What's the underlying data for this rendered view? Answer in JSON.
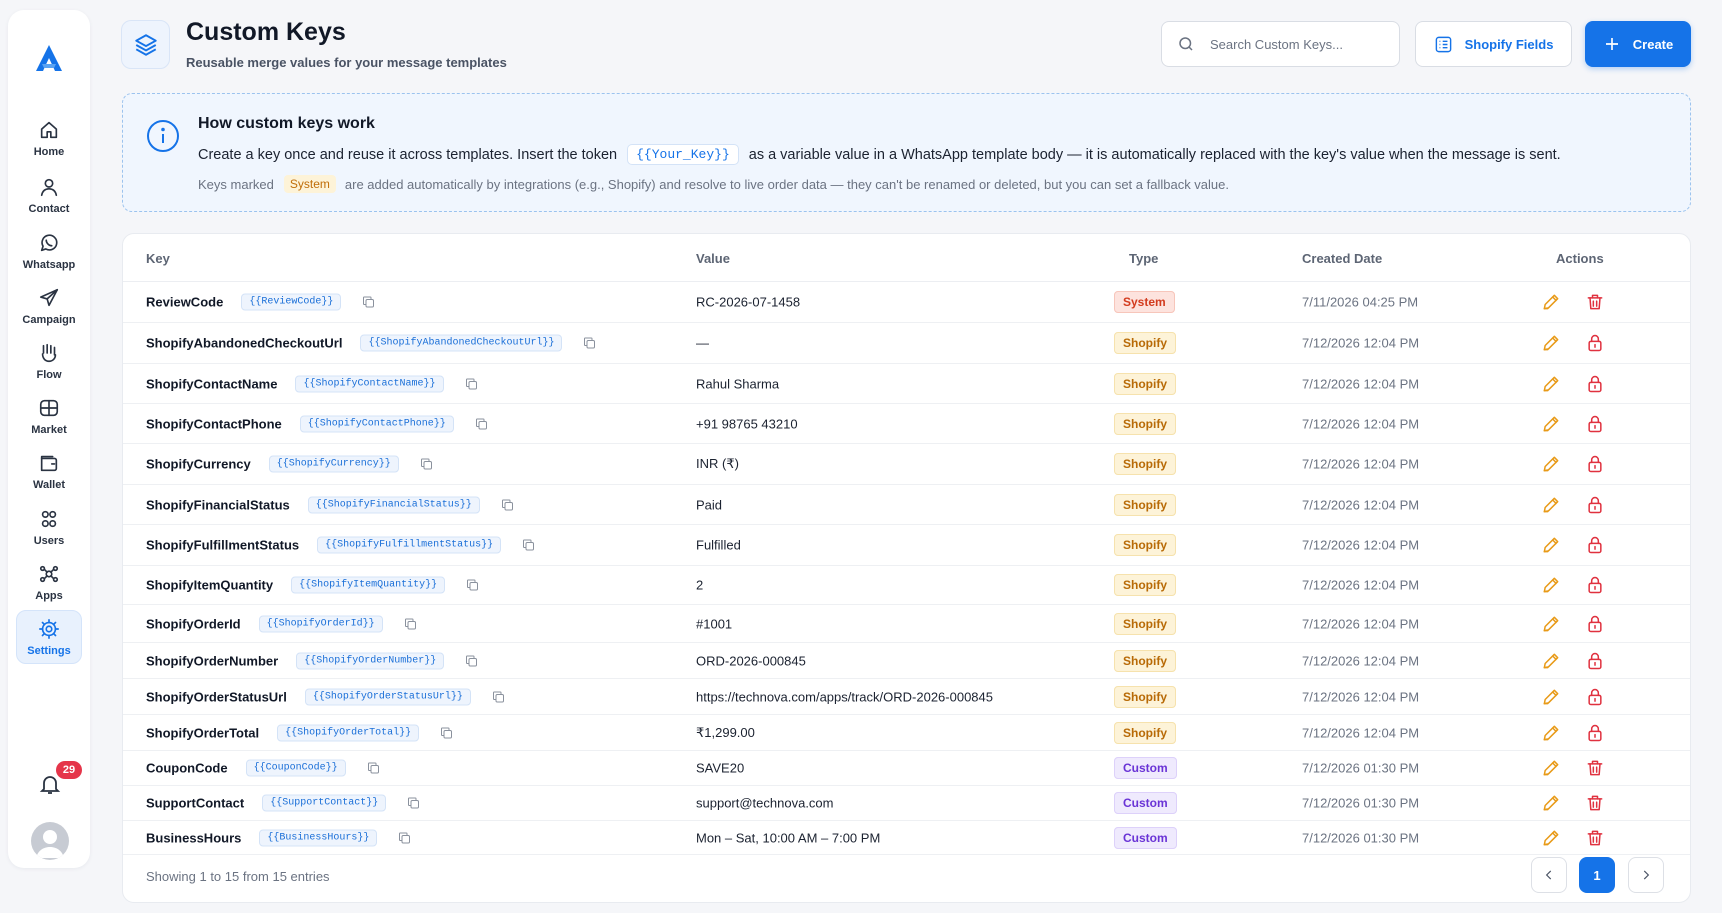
{
  "sidebar": {
    "items": [
      {
        "label": "Home",
        "icon": "home-icon"
      },
      {
        "label": "Contact",
        "icon": "user-icon"
      },
      {
        "label": "Whatsapp",
        "icon": "whatsapp-icon"
      },
      {
        "label": "Campaign",
        "icon": "send-icon"
      },
      {
        "label": "Flow",
        "icon": "flow-icon"
      },
      {
        "label": "Market",
        "icon": "store-icon"
      },
      {
        "label": "Wallet",
        "icon": "wallet-icon"
      },
      {
        "label": "Users",
        "icon": "users-icon"
      },
      {
        "label": "Apps",
        "icon": "apps-icon"
      },
      {
        "label": "Settings",
        "icon": "gear-icon",
        "active": true
      }
    ],
    "notification_count": "29"
  },
  "header": {
    "title": "Custom Keys",
    "subtitle": "Reusable merge values for your message templates",
    "search_placeholder": "Search Custom Keys...",
    "shopify_fields_label": "Shopify Fields",
    "create_label": "Create"
  },
  "info": {
    "title": "How custom keys work",
    "line1_before": "Create a key once and reuse it across templates. Insert the token",
    "line1_token": "{{Your_Key}}",
    "line1_after": "as a variable value in a WhatsApp template body — it is automatically replaced with the key's value when the message is sent.",
    "line2_before": "Keys marked",
    "line2_chip": "System",
    "line2_after": "are added automatically by integrations (e.g., Shopify) and resolve to live order data — they can't be renamed or deleted, but you can set a fallback value."
  },
  "table": {
    "headers": {
      "key": "Key",
      "value": "Value",
      "type": "Type",
      "created": "Created Date",
      "actions": "Actions"
    },
    "rows": [
      {
        "key": "ReviewCode",
        "token": "{{ReviewCode}}",
        "value": "RC-2026-07-1458",
        "type": "System",
        "date": "7/11/2026 04:25 PM"
      },
      {
        "key": "ShopifyAbandonedCheckoutUrl",
        "token": "{{ShopifyAbandonedCheckoutUrl}}",
        "value": "—",
        "type": "Shopify",
        "date": "7/12/2026 12:04 PM"
      },
      {
        "key": "ShopifyContactName",
        "token": "{{ShopifyContactName}}",
        "value": "Rahul Sharma",
        "type": "Shopify",
        "date": "7/12/2026 12:04 PM"
      },
      {
        "key": "ShopifyContactPhone",
        "token": "{{ShopifyContactPhone}}",
        "value": "+91 98765 43210",
        "type": "Shopify",
        "date": "7/12/2026 12:04 PM"
      },
      {
        "key": "ShopifyCurrency",
        "token": "{{ShopifyCurrency}}",
        "value": "INR (₹)",
        "type": "Shopify",
        "date": "7/12/2026 12:04 PM"
      },
      {
        "key": "ShopifyFinancialStatus",
        "token": "{{ShopifyFinancialStatus}}",
        "value": "Paid",
        "type": "Shopify",
        "date": "7/12/2026 12:04 PM"
      },
      {
        "key": "ShopifyFulfillmentStatus",
        "token": "{{ShopifyFulfillmentStatus}}",
        "value": "Fulfilled",
        "type": "Shopify",
        "date": "7/12/2026 12:04 PM"
      },
      {
        "key": "ShopifyItemQuantity",
        "token": "{{ShopifyItemQuantity}}",
        "value": "2",
        "type": "Shopify",
        "date": "7/12/2026 12:04 PM"
      },
      {
        "key": "ShopifyOrderId",
        "token": "{{ShopifyOrderId}}",
        "value": "#1001",
        "type": "Shopify",
        "date": "7/12/2026 12:04 PM"
      },
      {
        "key": "ShopifyOrderNumber",
        "token": "{{ShopifyOrderNumber}}",
        "value": "ORD-2026-000845",
        "type": "Shopify",
        "date": "7/12/2026 12:04 PM"
      },
      {
        "key": "ShopifyOrderStatusUrl",
        "token": "{{ShopifyOrderStatusUrl}}",
        "value": "https://technova.com/apps/track/ORD-2026-000845",
        "type": "Shopify",
        "date": "7/12/2026 12:04 PM"
      },
      {
        "key": "ShopifyOrderTotal",
        "token": "{{ShopifyOrderTotal}}",
        "value": "₹1,299.00",
        "type": "Shopify",
        "date": "7/12/2026 12:04 PM"
      },
      {
        "key": "CouponCode",
        "token": "{{CouponCode}}",
        "value": "SAVE20",
        "type": "Custom",
        "date": "7/12/2026 01:30 PM"
      },
      {
        "key": "SupportContact",
        "token": "{{SupportContact}}",
        "value": "support@technova.com",
        "type": "Custom",
        "date": "7/12/2026 01:30 PM"
      },
      {
        "key": "BusinessHours",
        "token": "{{BusinessHours}}",
        "value": "Mon – Sat, 10:00 AM – 7:00 PM",
        "type": "Custom",
        "date": "7/12/2026 01:30 PM"
      }
    ]
  },
  "footer": {
    "showing_text": "Showing 1 to 15 from 15 entries",
    "current_page": "1"
  },
  "colors": {
    "accent": "#1573e8",
    "system": "#d33b1e",
    "shopify": "#b86a06",
    "custom": "#6a34d6",
    "edit": "#e89a17",
    "delete": "#e0313f"
  }
}
